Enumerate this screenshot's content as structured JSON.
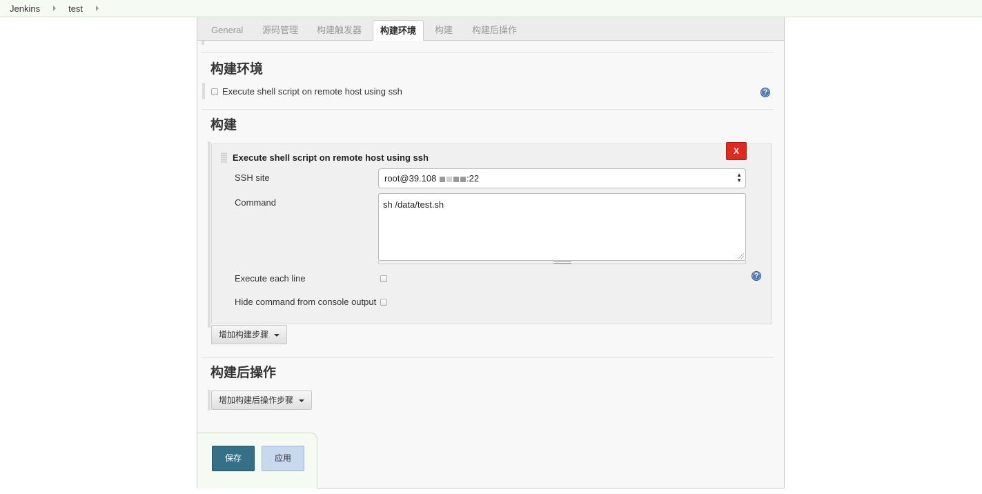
{
  "breadcrumb": {
    "items": [
      "Jenkins",
      "test"
    ]
  },
  "tabs": [
    "General",
    "源码管理",
    "构建触发器",
    "构建环境",
    "构建",
    "构建后操作"
  ],
  "active_tab": "构建环境",
  "build_env": {
    "title": "构建环境",
    "option_label": "Execute shell script on remote host using ssh",
    "help_icon": "help-icon"
  },
  "build": {
    "title": "构建",
    "step": {
      "title": "Execute shell script on remote host using ssh",
      "delete_label": "X",
      "ssh_site_label": "SSH site",
      "ssh_site_value_prefix": "root@39.108",
      "ssh_site_value_suffix": ":22",
      "command_label": "Command",
      "command_value": "sh  /data/test.sh",
      "execute_each_line_label": "Execute each line",
      "hide_command_label": "Hide command from console output"
    },
    "add_step_label": "增加构建步骤"
  },
  "post_build": {
    "title": "构建后操作",
    "add_step_label": "增加构建后操作步骤"
  },
  "actions": {
    "save_label": "保存",
    "apply_label": "应用"
  },
  "colors": {
    "save": "#357089",
    "apply": "#c8d9ef",
    "delete": "#e02a1d",
    "help": "#4a77b6"
  }
}
